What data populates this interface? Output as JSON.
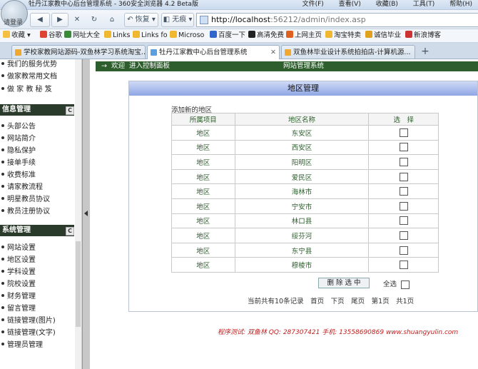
{
  "browser": {
    "logo_text": "请登录",
    "window_title": "牡丹江家教中心后台管理系统 - 360安全浏览器 4.2 Beta版",
    "menu": [
      "文件(F)",
      "查看(V)",
      "收藏(B)",
      "工具(T)",
      "帮助(H)"
    ],
    "nav": {
      "back_icon": "back-arrow-icon",
      "forward_icon": "forward-arrow-icon",
      "stop_icon": "close-icon",
      "refresh_icon": "refresh-icon",
      "home_icon": "home-icon",
      "restore_label": "恢复",
      "no_trace_label": "无痕"
    },
    "address": {
      "host": "http://localhost",
      "rest": ":56212/admin/index.asp"
    },
    "bookmarks": [
      "收藏",
      "谷歌",
      "网址大全",
      "Links",
      "Links fo",
      "Microso",
      "百度一下",
      "高清免费",
      "上网主页",
      "淘宝特卖",
      "诚信毕业",
      "新浪博客"
    ],
    "tabs": [
      {
        "label": "学校家教网站源码-双鱼林学习系统淘宝...",
        "active": false
      },
      {
        "label": "牡丹江家教中心后台管理系统",
        "active": true
      },
      {
        "label": "双鱼林毕业设计系统拍拍店-计算机源...",
        "active": false
      }
    ],
    "new_tab": "+"
  },
  "sidebar": {
    "top_items": [
      "我们的服务优势",
      "做家教常用文档",
      "做 家 教 秘 笈"
    ],
    "sections": [
      {
        "title": "信息管理",
        "items": [
          "头部公告",
          "网站简介",
          "隐私保护",
          "接单手续",
          "收费标准",
          "请家教流程",
          "明星教员协议",
          "教员注册协议"
        ]
      },
      {
        "title": "系统管理",
        "items": [
          "网站设置",
          "地区设置",
          "学科设置",
          "院校设置",
          "财务管理",
          "留言管理",
          "链接管理(图片)",
          "链接管理(文字)",
          "管理员管理"
        ]
      }
    ],
    "collapse_glyph": "C"
  },
  "main": {
    "topbar": {
      "arrow": "→",
      "welcome": "欢迎",
      "enter_panel": "进入控制面板",
      "system_name": "网站管理系统"
    },
    "panel": {
      "title": "地区管理",
      "add_link": "添加新的地区",
      "columns": [
        "所属项目",
        "地区名称",
        "选　择"
      ],
      "rows": [
        {
          "project": "地区",
          "name": "东安区"
        },
        {
          "project": "地区",
          "name": "西安区"
        },
        {
          "project": "地区",
          "name": "阳明区"
        },
        {
          "project": "地区",
          "name": "爱民区"
        },
        {
          "project": "地区",
          "name": "海林市"
        },
        {
          "project": "地区",
          "name": "宁安市"
        },
        {
          "project": "地区",
          "name": "林口县"
        },
        {
          "project": "地区",
          "name": "绥芬河"
        },
        {
          "project": "地区",
          "name": "东宁县"
        },
        {
          "project": "地区",
          "name": "穆棱市"
        }
      ],
      "delete_button": "删 除 选 中",
      "select_all": "全选",
      "pager": "当前共有10条记录　首页　下页　尾页　第1页　共1页"
    },
    "footer": "程序测试: 双鱼林  QQ: 287307421  手机: 13558690869  www.shuangyulin.com"
  }
}
